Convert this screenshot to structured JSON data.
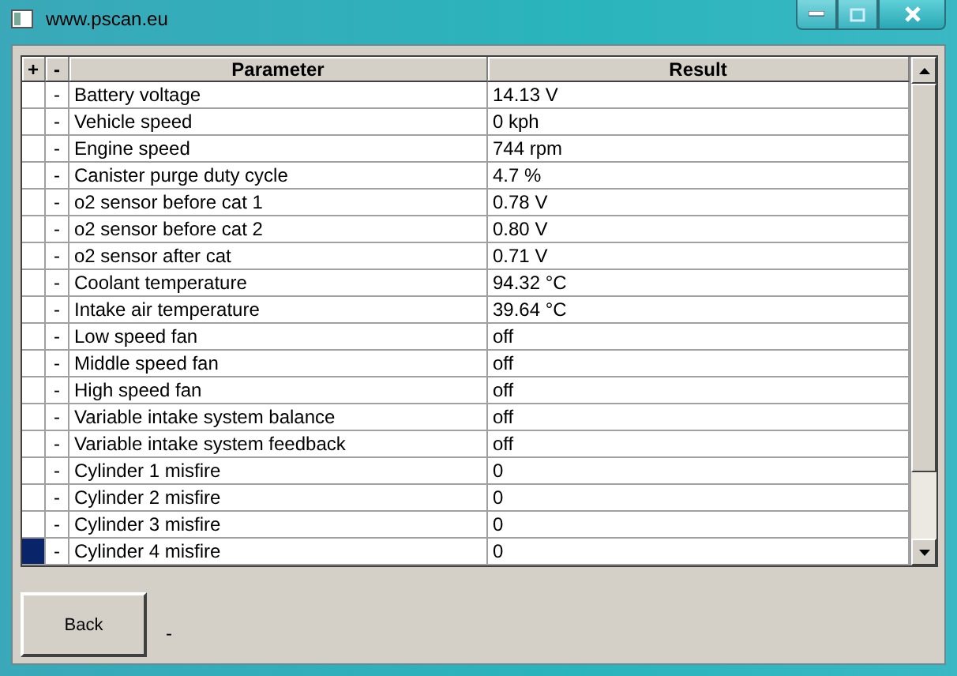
{
  "window": {
    "title": "www.pscan.eu"
  },
  "table": {
    "columns": [
      "+",
      "-",
      "Parameter",
      "Result"
    ],
    "rows": [
      {
        "mark": "-",
        "parameter": "Battery voltage",
        "result": "14.13 V",
        "selected": false
      },
      {
        "mark": "-",
        "parameter": "Vehicle speed",
        "result": "0 kph",
        "selected": false
      },
      {
        "mark": "-",
        "parameter": "Engine speed",
        "result": "744 rpm",
        "selected": false
      },
      {
        "mark": "-",
        "parameter": "Canister purge duty cycle",
        "result": "4.7 %",
        "selected": false
      },
      {
        "mark": "-",
        "parameter": "o2 sensor before cat 1",
        "result": "0.78 V",
        "selected": false
      },
      {
        "mark": "-",
        "parameter": "o2 sensor before cat 2",
        "result": "0.80 V",
        "selected": false
      },
      {
        "mark": "-",
        "parameter": "o2 sensor after cat",
        "result": "0.71 V",
        "selected": false
      },
      {
        "mark": "-",
        "parameter": "Coolant temperature",
        "result": "94.32 °C",
        "selected": false
      },
      {
        "mark": "-",
        "parameter": "Intake air temperature",
        "result": "39.64 °C",
        "selected": false
      },
      {
        "mark": "-",
        "parameter": "Low speed fan",
        "result": "off",
        "selected": false
      },
      {
        "mark": "-",
        "parameter": "Middle speed fan",
        "result": "off",
        "selected": false
      },
      {
        "mark": "-",
        "parameter": "High speed fan",
        "result": "off",
        "selected": false
      },
      {
        "mark": "-",
        "parameter": "Variable intake system balance",
        "result": "off",
        "selected": false
      },
      {
        "mark": "-",
        "parameter": "Variable intake system feedback",
        "result": "off",
        "selected": false
      },
      {
        "mark": "-",
        "parameter": "Cylinder 1 misfire",
        "result": "0",
        "selected": false
      },
      {
        "mark": "-",
        "parameter": "Cylinder 2 misfire",
        "result": "0",
        "selected": false
      },
      {
        "mark": "-",
        "parameter": "Cylinder 3 misfire",
        "result": "0",
        "selected": false
      },
      {
        "mark": "-",
        "parameter": "Cylinder 4 misfire",
        "result": "0",
        "selected": true
      }
    ]
  },
  "back_button": "Back",
  "status": "-"
}
